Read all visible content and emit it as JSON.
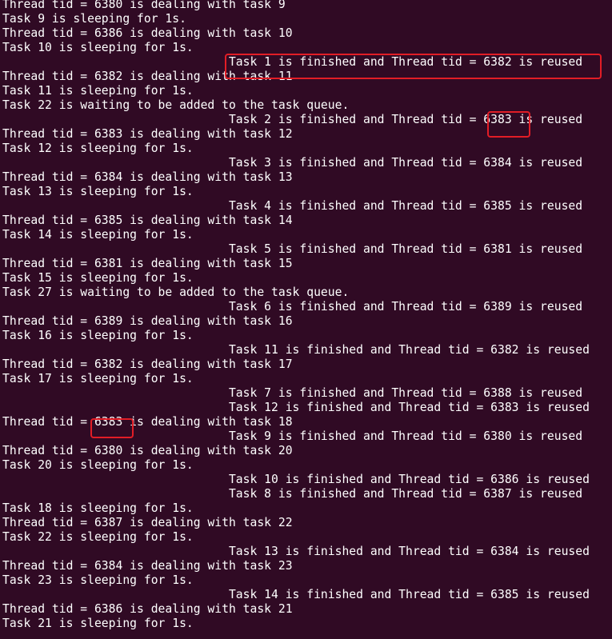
{
  "terminal": {
    "lines": [
      "Thread tid = 6380 is dealing with task 9",
      "Task 9 is sleeping for 1s.",
      "Thread tid = 6386 is dealing with task 10",
      "Task 10 is sleeping for 1s.",
      "                                Task 1 is finished and Thread tid = 6382 is reused",
      "Thread tid = 6382 is dealing with task 11",
      "Task 11 is sleeping for 1s.",
      "Task 22 is waiting to be added to the task queue.",
      "                                Task 2 is finished and Thread tid = 6383 is reused",
      "Thread tid = 6383 is dealing with task 12",
      "Task 12 is sleeping for 1s.",
      "                                Task 3 is finished and Thread tid = 6384 is reused",
      "Thread tid = 6384 is dealing with task 13",
      "Task 13 is sleeping for 1s.",
      "                                Task 4 is finished and Thread tid = 6385 is reused",
      "Thread tid = 6385 is dealing with task 14",
      "Task 14 is sleeping for 1s.",
      "                                Task 5 is finished and Thread tid = 6381 is reused",
      "Thread tid = 6381 is dealing with task 15",
      "Task 15 is sleeping for 1s.",
      "Task 27 is waiting to be added to the task queue.",
      "                                Task 6 is finished and Thread tid = 6389 is reused",
      "Thread tid = 6389 is dealing with task 16",
      "Task 16 is sleeping for 1s.",
      "                                Task 11 is finished and Thread tid = 6382 is reused",
      "Thread tid = 6382 is dealing with task 17",
      "Task 17 is sleeping for 1s.",
      "                                Task 7 is finished and Thread tid = 6388 is reused",
      "                                Task 12 is finished and Thread tid = 6383 is reused",
      "Thread tid = 6383 is dealing with task 18",
      "                                Task 9 is finished and Thread tid = 6380 is reused",
      "Thread tid = 6380 is dealing with task 20",
      "Task 20 is sleeping for 1s.",
      "                                Task 10 is finished and Thread tid = 6386 is reused",
      "                                Task 8 is finished and Thread tid = 6387 is reused",
      "Task 18 is sleeping for 1s.",
      "Thread tid = 6387 is dealing with task 22",
      "Task 22 is sleeping for 1s.",
      "                                Task 13 is finished and Thread tid = 6384 is reused",
      "Thread tid = 6384 is dealing with task 23",
      "Task 23 is sleeping for 1s.",
      "                                Task 14 is finished and Thread tid = 6385 is reused",
      "Thread tid = 6386 is dealing with task 21",
      "Task 21 is sleeping for 1s."
    ]
  },
  "colors": {
    "background": "#300a24",
    "text": "#ffffff",
    "highlight_border": "#e21d26"
  }
}
